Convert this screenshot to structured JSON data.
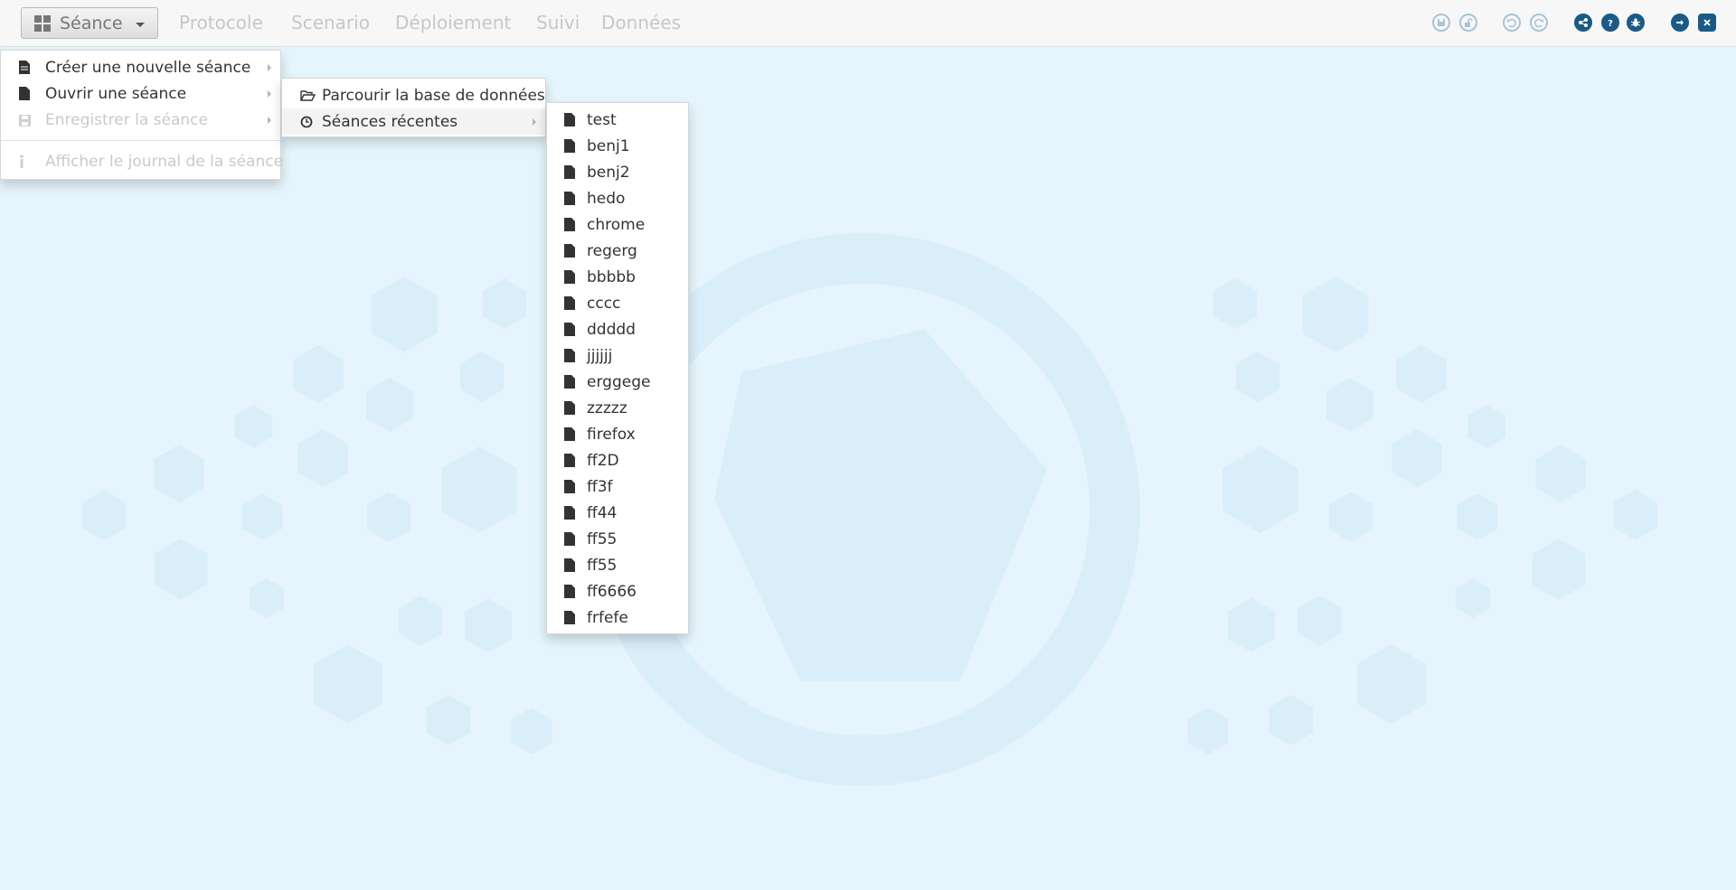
{
  "navbar": {
    "seance_label": "Séance",
    "links": [
      "Protocole",
      "Scenario",
      "Déploiement",
      "Suivi",
      "Données"
    ]
  },
  "toolbar": {
    "icons": [
      "save-icon",
      "unlock-icon",
      "undo-icon",
      "redo-icon",
      "share-icon",
      "help-icon",
      "bug-icon",
      "sign-out-icon",
      "close-icon"
    ]
  },
  "seance_menu": {
    "items": [
      {
        "label": "Créer une nouvelle séance",
        "icon": "file-icon",
        "has_submenu": true,
        "enabled": true
      },
      {
        "label": "Ouvrir une séance",
        "icon": "file-icon",
        "has_submenu": true,
        "enabled": true
      },
      {
        "label": "Enregistrer la séance",
        "icon": "save-icon",
        "has_submenu": true,
        "enabled": false
      },
      {
        "label": "Afficher le journal de la séance",
        "icon": "info-icon",
        "has_submenu": false,
        "enabled": false
      }
    ]
  },
  "open_submenu": {
    "items": [
      {
        "label": "Parcourir la base de données",
        "icon": "folder-open-icon"
      },
      {
        "label": "Séances récentes",
        "icon": "clock-icon"
      }
    ]
  },
  "recent_sessions": [
    "test",
    "benj1",
    "benj2",
    "hedo",
    "chrome",
    "regerg",
    "bbbbb",
    "cccc",
    "ddddd",
    "jjjjjj",
    "erggege",
    "zzzzz",
    "firefox",
    "ff2D",
    "ff3f",
    "ff44",
    "ff55",
    "ff55",
    "ff6666",
    "frfefe"
  ],
  "colors": {
    "background": "#e6f5fd",
    "toolbar_active": "#1a5a86",
    "toolbar_inactive": "#a7c4d8"
  }
}
